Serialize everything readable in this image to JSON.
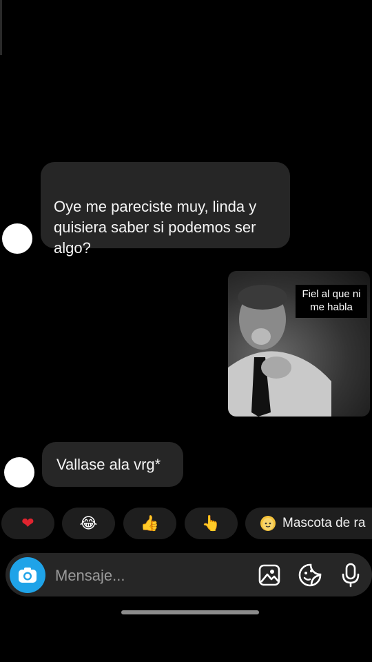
{
  "messages": [
    {
      "direction": "incoming",
      "text": "Oye me pareciste muy, linda y\nquisiera saber si podemos ser\nalgo?"
    },
    {
      "direction": "outgoing",
      "type": "image",
      "caption": "Fiel al que ni\nme habla"
    },
    {
      "direction": "incoming",
      "text": "Vallase ala vrg*"
    }
  ],
  "quick_reactions": [
    {
      "icon": "red-heart-icon",
      "glyph": "❤"
    },
    {
      "icon": "laughing-tears-icon",
      "glyph": "😂"
    },
    {
      "icon": "thumbs-up-icon",
      "glyph": "👍"
    },
    {
      "icon": "pointing-hand-icon",
      "glyph": "👆"
    },
    {
      "icon": "egg-icon",
      "label": "Mascota de ra"
    }
  ],
  "composer": {
    "placeholder": "Mensaje..."
  },
  "colors": {
    "background": "#000000",
    "bubble": "#262626",
    "camera_button": "#1fa3e8"
  }
}
